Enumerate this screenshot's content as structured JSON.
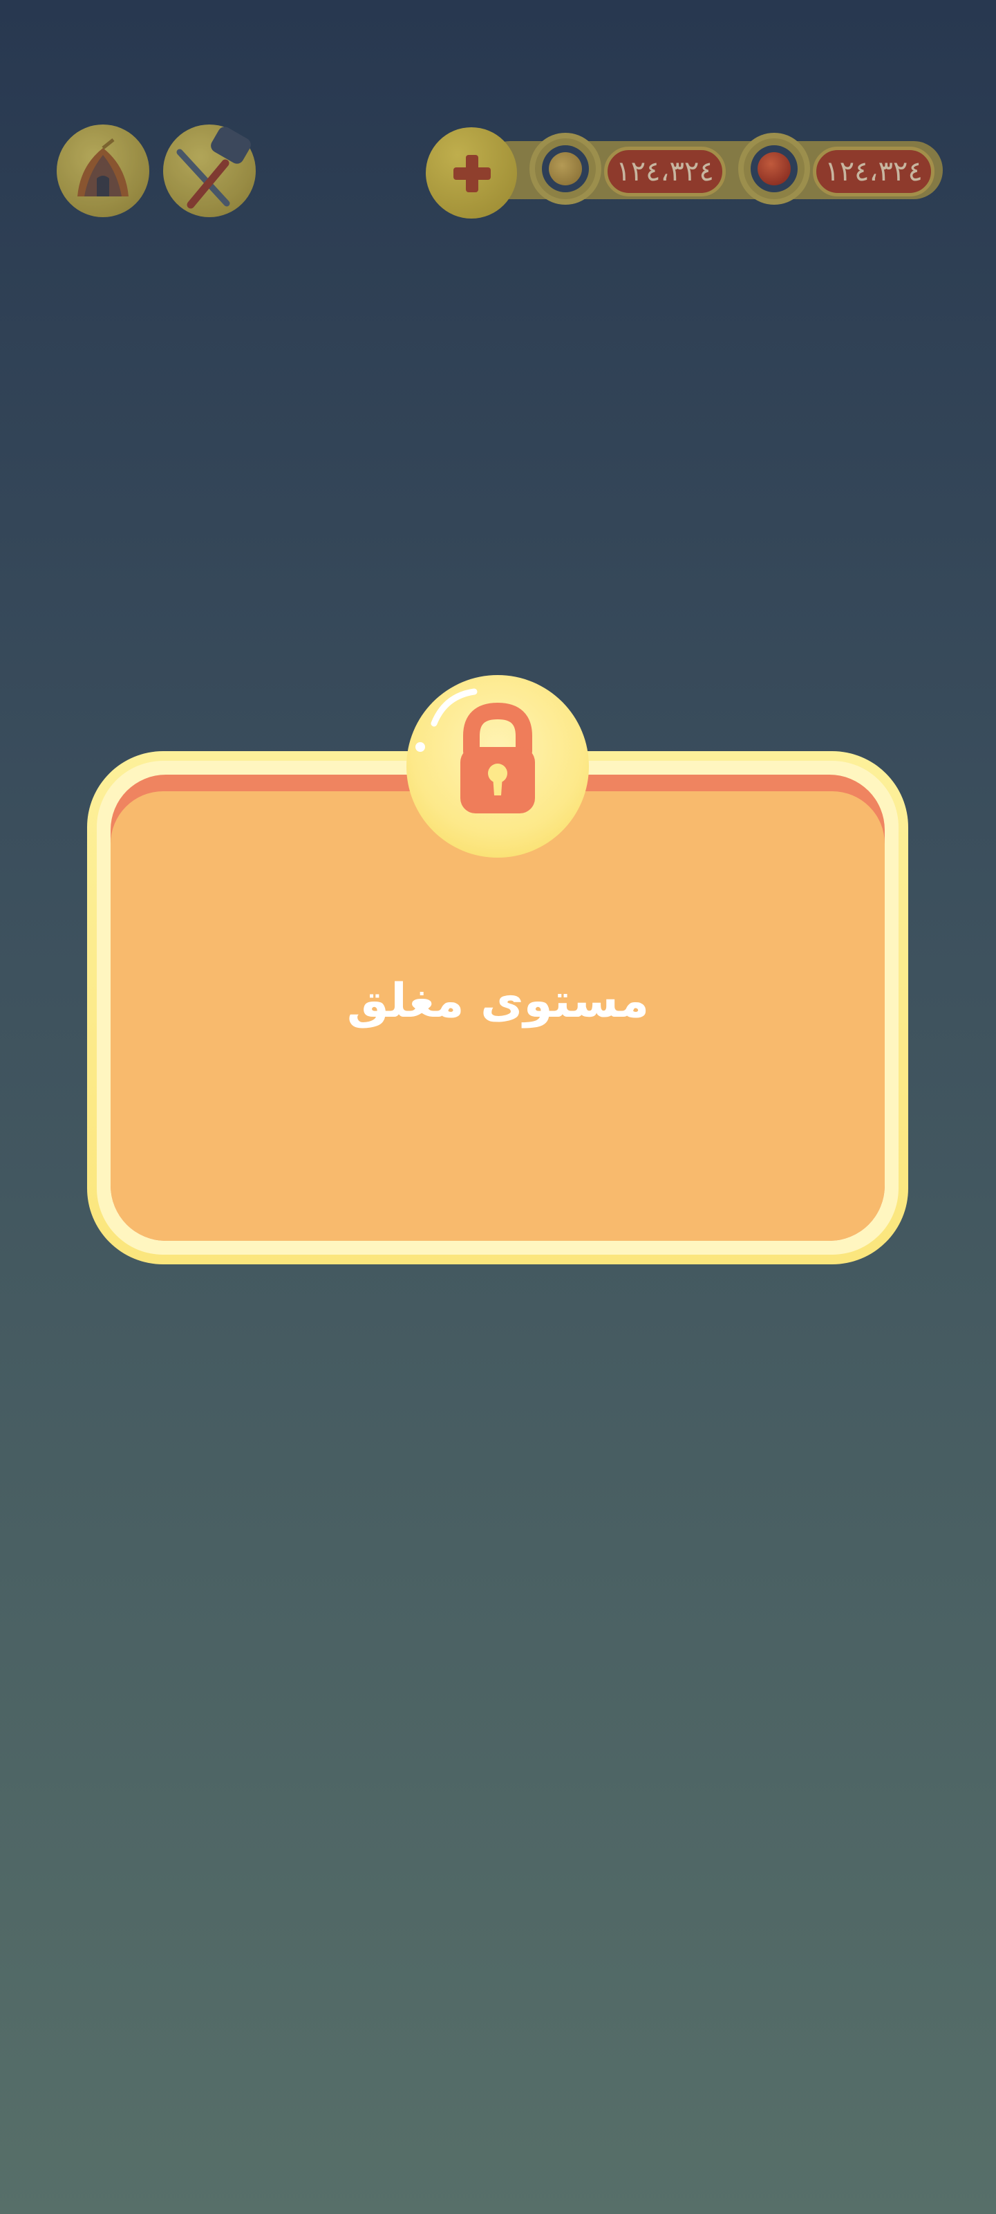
{
  "hud": {
    "left_icons": [
      {
        "name": "home-tent-icon"
      },
      {
        "name": "hammer-tools-icon"
      }
    ],
    "currency": [
      {
        "icon": "coin-icon",
        "amount": "١٢٤،٣٢٤"
      },
      {
        "icon": "gem-icon",
        "amount": "١٢٤،٣٢٤"
      }
    ],
    "add_button_icon": "plus-icon"
  },
  "dialog": {
    "icon": "padlock-icon",
    "title": "مستوی مغلق"
  },
  "colors": {
    "background_top": "#283850",
    "background_bottom": "#576f69",
    "dialog_frame": "#fdf09a",
    "dialog_panel": "#f8ba6d",
    "dialog_header_stripe": "#ef8460",
    "lock": "#ef7d5a"
  }
}
